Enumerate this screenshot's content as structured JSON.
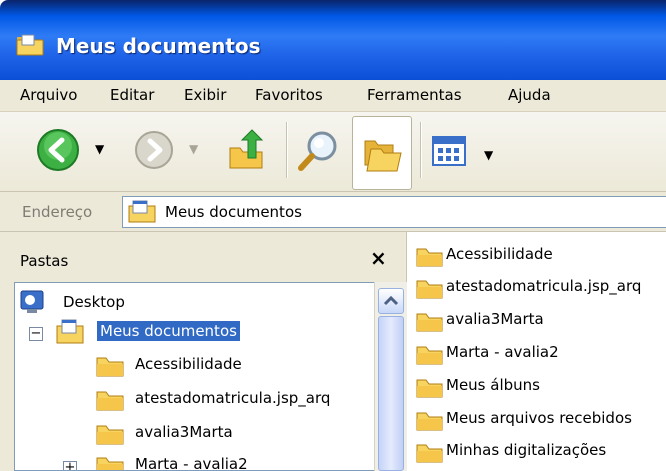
{
  "window": {
    "title": "Meus documentos"
  },
  "menubar": {
    "items": [
      "Arquivo",
      "Editar",
      "Exibir",
      "Favoritos",
      "Ferramentas",
      "Ajuda"
    ]
  },
  "toolbar": {
    "buttons": [
      "back-icon",
      "forward-icon",
      "up-folder-icon",
      "search-icon",
      "folders-icon",
      "views-icon"
    ]
  },
  "addressbar": {
    "label": "Endereço",
    "value": "Meus documentos"
  },
  "folders_pane": {
    "title": "Pastas",
    "close": "×",
    "tree": [
      {
        "label": "Desktop",
        "level": 0,
        "expander": ""
      },
      {
        "label": "Meus documentos",
        "level": 1,
        "expander": "−",
        "selected": true
      },
      {
        "label": "Acessibilidade",
        "level": 2,
        "expander": ""
      },
      {
        "label": "atestadomatricula.jsp_arq",
        "level": 2,
        "expander": ""
      },
      {
        "label": "avalia3Marta",
        "level": 2,
        "expander": ""
      },
      {
        "label": "Marta - avalia2",
        "level": 2,
        "expander": "+"
      }
    ]
  },
  "content": {
    "items": [
      "Acessibilidade",
      "atestadomatricula.jsp_arq",
      "avalia3Marta",
      "Marta - avalia2",
      "Meus álbuns",
      "Meus arquivos recebidos",
      "Minhas digitalizações"
    ]
  },
  "colors": {
    "titlebar": "#0058e6",
    "chrome": "#ece9d8",
    "selection": "#316ac5",
    "folder": "#f5c64a"
  }
}
